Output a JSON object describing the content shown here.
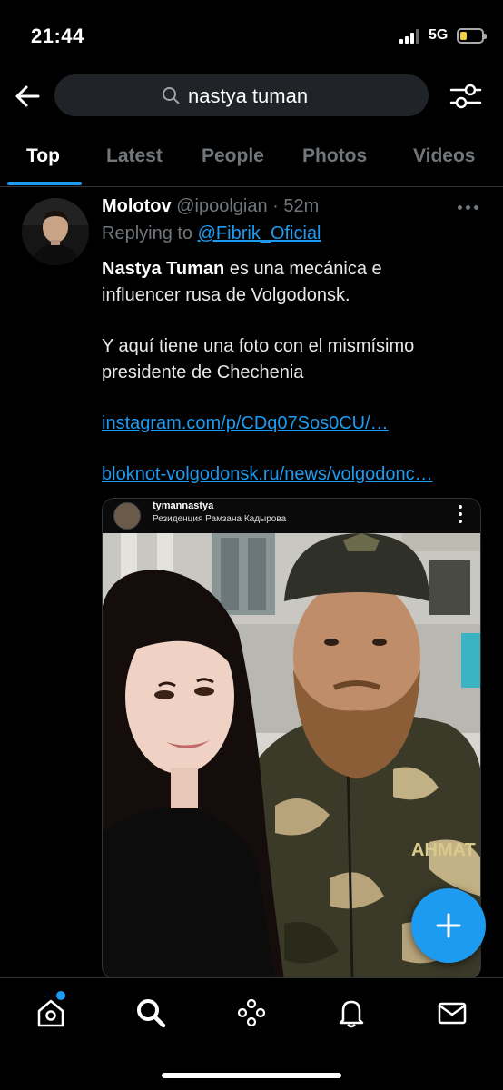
{
  "status_bar": {
    "time": "21:44",
    "network": "5G"
  },
  "search": {
    "query": "nastya tuman"
  },
  "tabs": [
    {
      "label": "Top",
      "active": true
    },
    {
      "label": "Latest",
      "active": false
    },
    {
      "label": "People",
      "active": false
    },
    {
      "label": "Photos",
      "active": false
    },
    {
      "label": "Videos",
      "active": false
    }
  ],
  "tweet": {
    "author_name": "Molotov",
    "author_handle": "@ipoolgian",
    "time_ago": "· 52m",
    "replying_prefix": "Replying to ",
    "replying_to": "@Fibrik_Oficial",
    "text_bold": "Nastya Tuman",
    "text_line1_rest": " es una mecánica e",
    "text_line2": "influencer rusa de Volgodonsk.",
    "text_line3": "Y aquí tiene una foto con el mismísimo",
    "text_line4": "presidente de Chechenia",
    "link1": "instagram.com/p/CDq07Sos0CU/…",
    "link2": "bloknot-volgodonsk.ru/news/volgodonc…",
    "media": {
      "ig_username": "tymannastya",
      "ig_location": "Резиденция Рамзана Кадырова",
      "shirt_text": "AHMAT"
    }
  },
  "colors": {
    "accent": "#1d9bf0",
    "background": "#000000",
    "secondary_text": "#71767b",
    "search_bg": "#202327"
  },
  "icons": {
    "back": "arrow-left-icon",
    "search": "search-icon",
    "filter": "sliders-icon",
    "more": "ellipsis-icon",
    "fab": "plus-icon",
    "nav": [
      "home-icon",
      "explore-search-icon",
      "spaces-icon",
      "notifications-bell-icon",
      "messages-mail-icon"
    ]
  }
}
